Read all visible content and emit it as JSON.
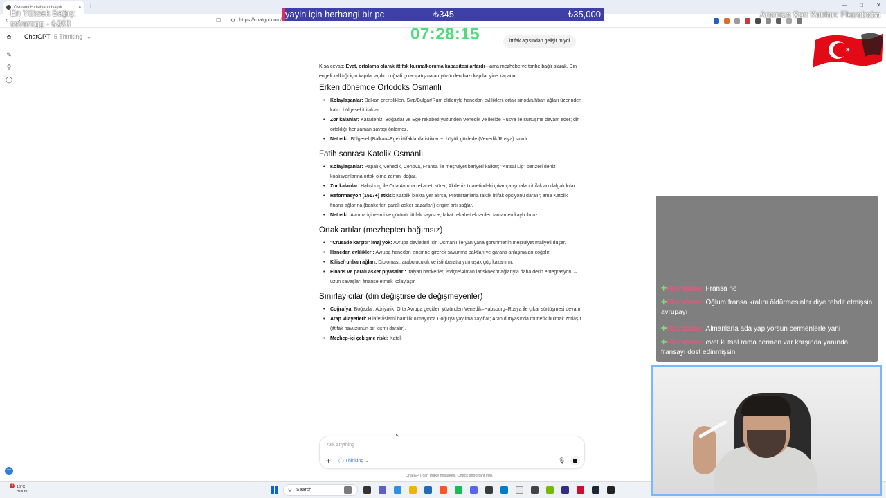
{
  "browser": {
    "tab_title": "Osmanlı Hıristiyan olsaydı",
    "tab_close": "×",
    "new_tab": "+",
    "url": "https://chatgpt.com/c/68829..."
  },
  "chatgpt": {
    "model_name": "ChatGPT",
    "model_mode": "5 Thinking",
    "user_avatar": "TT",
    "user_message": "ittifak açısından gelişir miydi",
    "answer": {
      "lead_label": "Kısa cevap:",
      "lead_bold": "Evet, ortalama olarak ittifak kurma/koruma kapasitesi artardı—",
      "lead_rest": "ama mezhebe ve tarihe bağlı olarak. Din engeli kalktığı için kapılar açılır; coğrafi çıkar çatışmaları yüzünden bazı kapılar yine kapanır.",
      "sections": [
        {
          "title": "Erken dönemde Ortodoks Osmanlı",
          "items": [
            {
              "label": "Kolaylaşanlar:",
              "text": "Balkan prenslikleri, Sırp/Bulgar/Rum elitleriyle hanedan evlilikleri, ortak sinod/ruhban ağları üzerinden kalıcı bölgesel ittifaklar."
            },
            {
              "label": "Zor kalanlar:",
              "text": "Karadeniz–Boğazlar ve Ege rekabeti yüzünden Venedik ve ileride Rusya ile sürtüşme devam eder; din ortaklığı her zaman savaşı önlemez."
            },
            {
              "label": "Net etki:",
              "text": "Bölgesel (Balkan–Ege) ittifaklarda istikrar +, büyük güçlerle (Venedik/Rusya) sınırlı."
            }
          ]
        },
        {
          "title": "Fatih sonrası Katolik Osmanlı",
          "items": [
            {
              "label": "Kolaylaşanlar:",
              "text": "Papalık, Venedik, Cenova, Fransa ile meşruiyet bariyeri kalkar; \"Kutsal Lig\" benzeri deniz koalisyonlarına ortak olma zemini doğar."
            },
            {
              "label": "Zor kalanlar:",
              "text": "Habsburg ile Orta Avrupa rekabeti sürer; Akdeniz ticaretindeki çıkar çatışmaları ittifakları dalgalı kılar."
            },
            {
              "label": "Reformasyon (1517+) etkisi:",
              "text": "Katolik blokta yer alırsa, Protestanlarla taktik ittifak opsiyonu daralır; ama Katolik finans-ağlarına (bankerler, paralı asker pazarları) erişim artı sağlar."
            },
            {
              "label": "Net etki:",
              "text": "Avrupa içi resmi ve görünür ittifak sayısı +, fakat rekabet eksenleri tamamen kaybolmaz."
            }
          ]
        },
        {
          "title": "Ortak artılar (mezhepten bağımsız)",
          "items": [
            {
              "label": "\"Crusade karşıtı\" imaj yok:",
              "text": "Avrupa devletleri için Osmanlı ile yan yana görünmenin meşruiyet maliyeti düşer."
            },
            {
              "label": "Hanedan evlilikleri:",
              "text": "Avrupa hanedan zincirine girerek savunma paktları ve garanti anlaşmaları çoğalır."
            },
            {
              "label": "Kilise/ruhban ağları:",
              "text": "Diplomasi, arabuluculuk ve istihbaratta yumuşak güç kazanımı."
            },
            {
              "label": "Finans ve paralı asker piyasaları:",
              "text": "İtalyan bankerler, İsviçre/Alman lansknecht ağlarıyla daha derin entegrasyon → uzun savaşları finanse etmek kolaylaşır."
            }
          ]
        },
        {
          "title": "Sınırlayıcılar (din değiştirse de değişmeyenler)",
          "items": [
            {
              "label": "Coğrafya:",
              "text": "Boğazlar, Adriyatik, Orta Avrupa geçitleri yüzünden Venedik–Habsburg–Rusya ile çıkar sürtüşmesi devam."
            },
            {
              "label": "Arap vilayetleri:",
              "text": "Hilafet/İslamî hamilik olmayınca Doğu'ya yayılma zayıflar; Arap dünyasında müttefik bulmak zorlaşır (ittifak havuzunun bir kısmı daralır)."
            },
            {
              "label": "Mezhep-içi çekişme riski:",
              "text": "Katoli"
            }
          ]
        }
      ]
    },
    "composer": {
      "placeholder": "Ask anything",
      "plus": "+",
      "thinking_label": "Thinking",
      "disclaimer": "ChatGPT can make mistakes. Check important info."
    }
  },
  "taskbar": {
    "weather_temp": "16°C",
    "weather_desc": "Bulutlu",
    "weather_badge": "3",
    "search_placeholder": "Search",
    "start_color": "#0a64d8"
  },
  "overlay": {
    "top_donor_title": "En Yüksek Bağış:",
    "top_donor_value": "ssvarogg - ₺200",
    "new_follower": "Aramıza Son Katılan: Fkarababa",
    "donation_goal_label": "yayin için herhangi bir pc",
    "donation_current": "₺345",
    "donation_target": "₺35,000",
    "donation_progress": 0.0099,
    "timer": "07:28:15",
    "chat": [
      {
        "user": "Fkarababa:",
        "text": "Fransa ne"
      },
      {
        "user": "Fkarababa:",
        "text": "Oğlum fransa kralını öldürmesinler diye tehdit etmişsin avrupayı"
      },
      {
        "user": "Fkarababa:",
        "text": "Almanlarla ada yapıyorsun cermenlerle yani"
      },
      {
        "user": "Fkarababa:",
        "text": "evet kutsal roma cermen var karşında yanında fransayı dost edinmişsin"
      }
    ],
    "chat_star": "✚"
  },
  "colors": {
    "donation_bar": "#3f3fa8",
    "timer": "#4ddb7c",
    "chat_user": "#e4577f",
    "accent": "#2f7de1"
  }
}
